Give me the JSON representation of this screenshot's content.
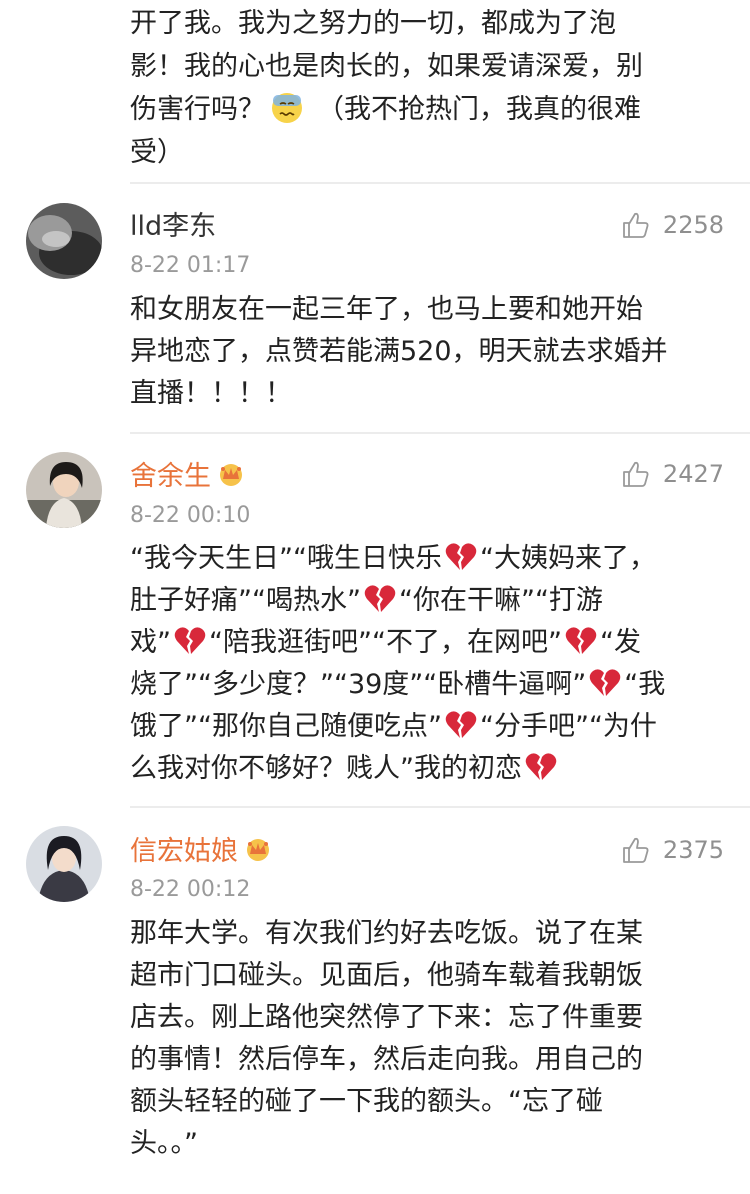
{
  "top_comment": {
    "lines": [
      "开了我。我为之努力的一切，都成为了泡",
      "影！我的心也是肉长的，如果爱请深爱，别",
      "伤害行吗？",
      "（我不抢热门，我真的很难",
      "受）"
    ],
    "emoji": "sweat-face-icon"
  },
  "comments": [
    {
      "username": "lld李东",
      "time": "8-22 01:17",
      "likes": "2258",
      "vip": false,
      "lines": [
        "和女朋友在一起三年了，也马上要和她开始",
        "异地恋了，点赞若能满520，明天就去求婚并",
        "直播！！！！"
      ]
    },
    {
      "username": "舍余生",
      "time": "8-22 00:10",
      "likes": "2427",
      "vip": true,
      "segments": [
        [
          "“我今天生日”“哦生日快乐",
          "HEART",
          "“大姨妈来了，"
        ],
        [
          "肚子好痛”“喝热水”",
          "HEART",
          "“你在干嘛”“打游"
        ],
        [
          "戏”",
          "HEART",
          "“陪我逛街吧”“不了，在网吧”",
          "HEART",
          "“发"
        ],
        [
          "烧了”“多少度？”“39度”“卧槽牛逼啊”",
          "HEART",
          "“我"
        ],
        [
          "饿了”“那你自己随便吃点”",
          "HEART",
          "“分手吧”“为什"
        ],
        [
          "么我对你不够好？贱人”我的初恋",
          "HEART"
        ]
      ]
    },
    {
      "username": "信宏姑娘",
      "time": "8-22 00:12",
      "likes": "2375",
      "vip": true,
      "lines": [
        "那年大学。有次我们约好去吃饭。说了在某",
        "超市门口碰头。见面后，他骑车载着我朝饭",
        "店去。刚上路他突然停了下来：忘了件重要",
        "的事情！然后停车，然后走向我。用自己的",
        "额头轻轻的碰了一下我的额头。“忘了碰",
        "头。。”"
      ]
    }
  ],
  "colors": {
    "vip_name": "#e8733a",
    "time": "#9a9a9a",
    "like": "#8f8f8f",
    "heart": "#d8283a"
  }
}
